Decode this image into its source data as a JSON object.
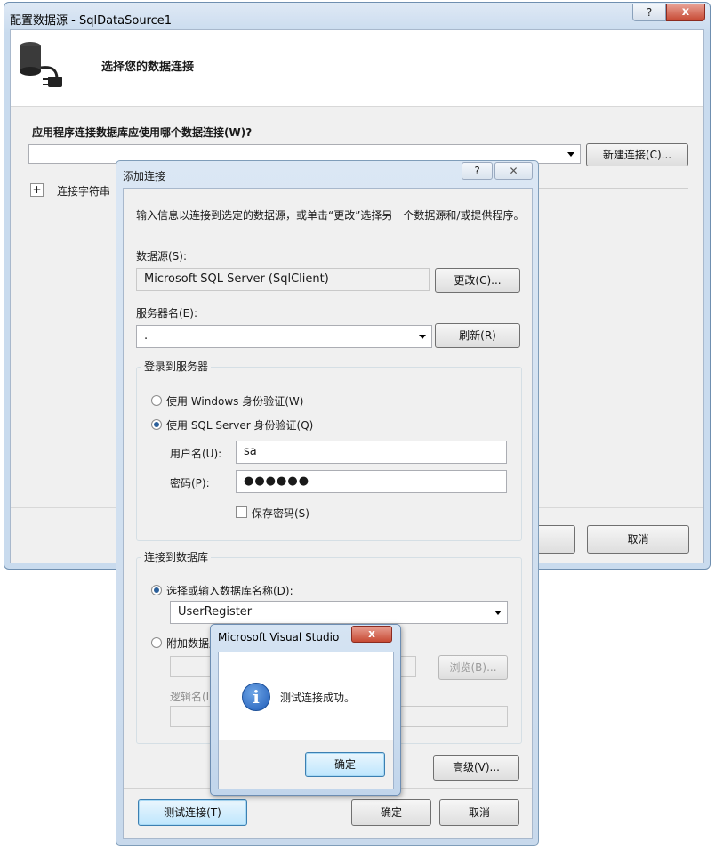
{
  "outer": {
    "title": "配置数据源 - SqlDataSource1",
    "header_text": "选择您的数据连接",
    "question": "应用程序连接数据库应使用哪个数据连接(W)?",
    "new_conn_label": "新建连接(C)...",
    "conn_string_label": "连接字符串",
    "cancel_label": "取消",
    "help_glyph": "?",
    "close_glyph": "x",
    "expand_glyph": "+"
  },
  "add_conn": {
    "title": "添加连接",
    "intro": "输入信息以连接到选定的数据源，或单击“更改”选择另一个数据源和/或提供程序。",
    "datasource_label": "数据源(S):",
    "datasource_value": "Microsoft SQL Server (SqlClient)",
    "change_label": "更改(C)...",
    "server_label": "服务器名(E):",
    "server_value": ".",
    "refresh_label": "刷新(R)",
    "login_group": "登录到服务器",
    "win_auth": "使用 Windows 身份验证(W)",
    "sql_auth": "使用 SQL Server 身份验证(Q)",
    "user_label": "用户名(U):",
    "user_value": "sa",
    "pwd_label": "密码(P):",
    "pwd_value": "●●●●●●",
    "save_pwd": "保存密码(S)",
    "db_group": "连接到数据库",
    "select_db": "选择或输入数据库名称(D):",
    "db_value": "UserRegister",
    "attach_db": "附加数据库",
    "browse_label": "浏览(B)...",
    "logical_label": "逻辑名(L)",
    "advanced_label": "高级(V)...",
    "test_label": "测试连接(T)",
    "ok_label": "确定",
    "cancel_label": "取消",
    "help_glyph": "?",
    "close_glyph": "✕"
  },
  "msgbox": {
    "title": "Microsoft Visual Studio",
    "message": "测试连接成功。",
    "ok_label": "确定",
    "close_glyph": "x",
    "info_glyph": "i"
  }
}
